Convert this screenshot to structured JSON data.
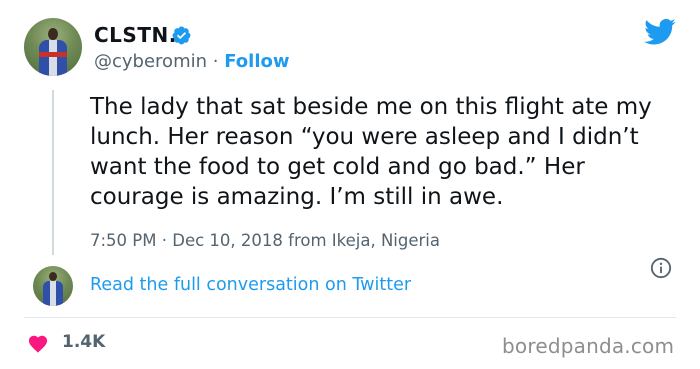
{
  "author": {
    "display_name": "CLSTN.",
    "handle": "@cyberomin",
    "separator": "·",
    "follow_label": "Follow"
  },
  "tweet": {
    "text": "The lady that sat beside me on this flight ate my lunch. Her reason “you were asleep and I didn’t want the food to get cold and go bad.” Her courage is amazing. I’m still in awe.",
    "time": "7:50 PM",
    "separator": "·",
    "date": "Dec 10, 2018",
    "location": "from Ikeja, Nigeria"
  },
  "conversation": {
    "link_label": "Read the full conversation on Twitter"
  },
  "engagement": {
    "likes": "1.4K"
  },
  "watermark": "boredpanda.com",
  "colors": {
    "accent": "#1d9bf0",
    "heart": "#f91880",
    "muted_text": "#536471",
    "text": "#0f1419"
  },
  "icons": {
    "verified": "verified-badge-icon",
    "brand": "twitter-bird-icon",
    "info": "info-icon",
    "like": "heart-icon"
  }
}
